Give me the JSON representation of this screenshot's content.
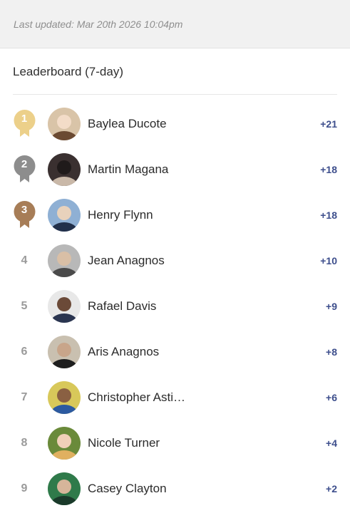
{
  "header": {
    "last_updated": "Last updated: Mar 20th 2026 10:04pm"
  },
  "leaderboard": {
    "title": "Leaderboard (7-day)",
    "colors": {
      "gold": "#ecd08a",
      "silver": "#8d8d8d",
      "bronze": "#a77d57",
      "score": "#3d4e8c"
    },
    "entries": [
      {
        "rank": "1",
        "medal": "gold",
        "name": "Baylea Ducote",
        "score": "+21",
        "avatar_icon": "avatar-photo-icon"
      },
      {
        "rank": "2",
        "medal": "silver",
        "name": "Martin Magana",
        "score": "+18",
        "avatar_icon": "avatar-photo-icon"
      },
      {
        "rank": "3",
        "medal": "bronze",
        "name": "Henry Flynn",
        "score": "+18",
        "avatar_icon": "avatar-photo-icon"
      },
      {
        "rank": "4",
        "medal": "",
        "name": "Jean Anagnos",
        "score": "+10",
        "avatar_icon": "avatar-photo-icon"
      },
      {
        "rank": "5",
        "medal": "",
        "name": "Rafael Davis",
        "score": "+9",
        "avatar_icon": "avatar-photo-icon"
      },
      {
        "rank": "6",
        "medal": "",
        "name": "Aris Anagnos",
        "score": "+8",
        "avatar_icon": "avatar-photo-icon"
      },
      {
        "rank": "7",
        "medal": "",
        "name": "Christopher Asti…",
        "score": "+6",
        "avatar_icon": "avatar-photo-icon"
      },
      {
        "rank": "8",
        "medal": "",
        "name": "Nicole Turner",
        "score": "+4",
        "avatar_icon": "avatar-photo-icon"
      },
      {
        "rank": "9",
        "medal": "",
        "name": "Casey Clayton",
        "score": "+2",
        "avatar_icon": "avatar-photo-icon"
      }
    ]
  }
}
